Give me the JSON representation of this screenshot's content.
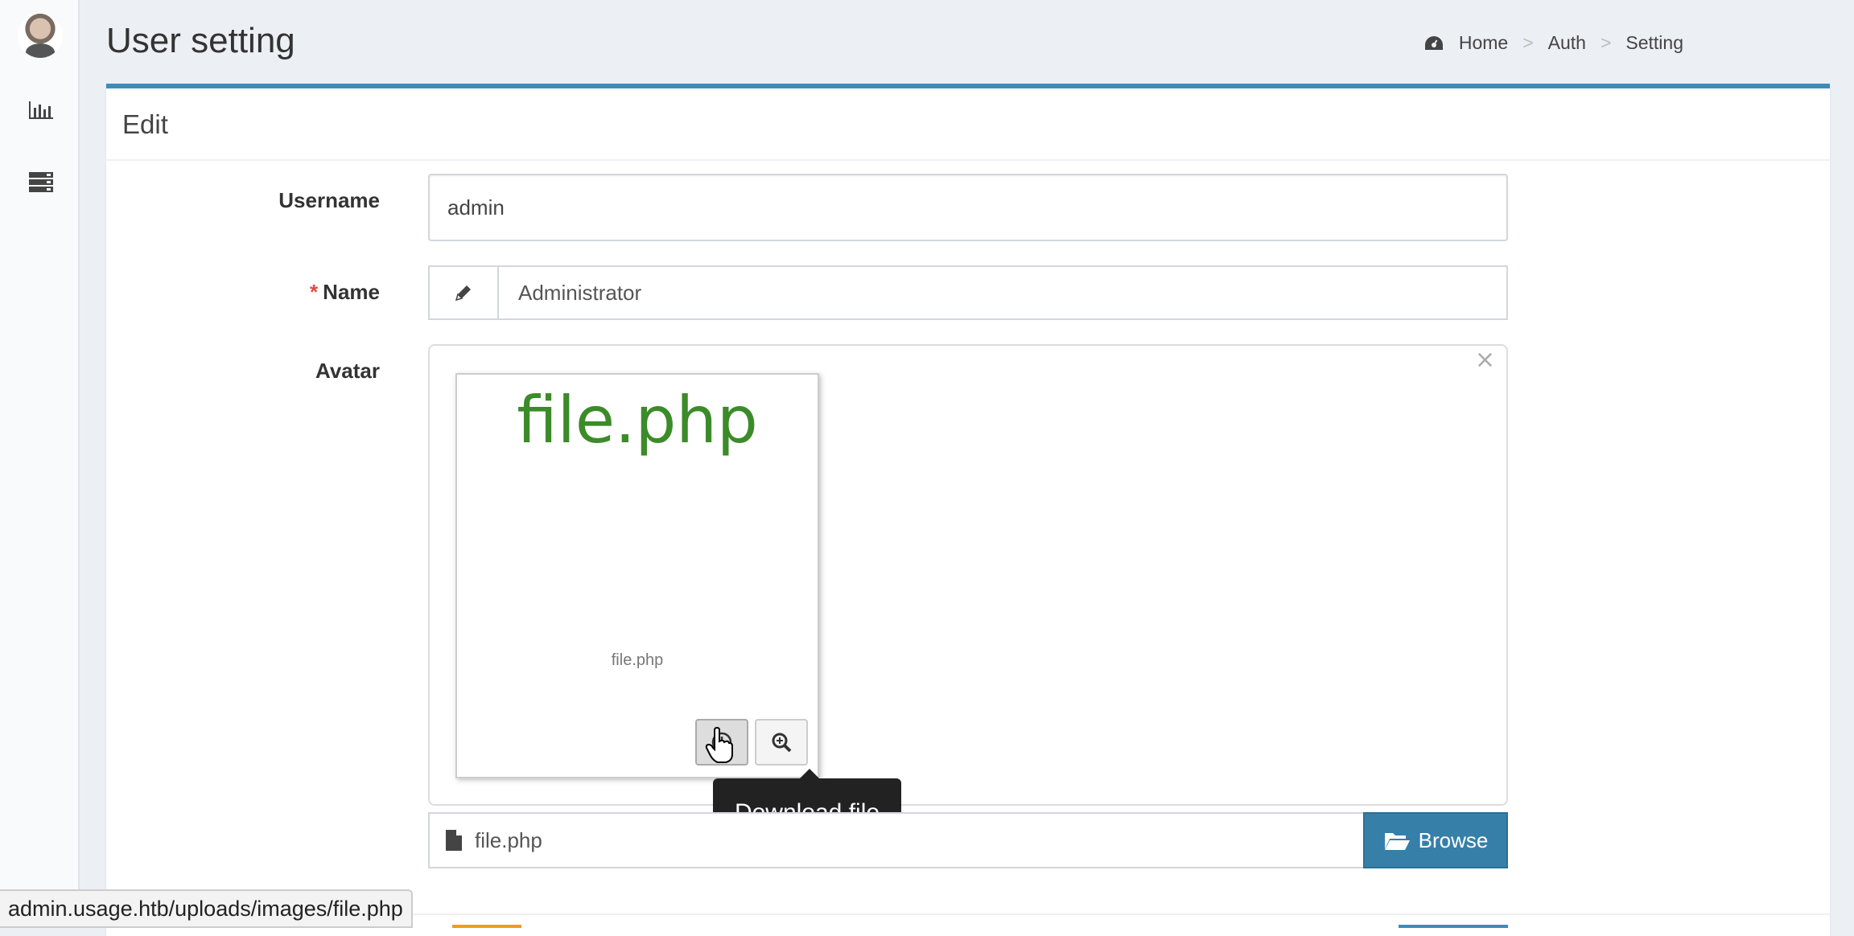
{
  "header": {
    "title": "User setting",
    "breadcrumb": [
      "Home",
      "Auth",
      "Setting"
    ],
    "breadcrumb_separator": ">"
  },
  "sidebar": {
    "icons": [
      "avatar",
      "bar-chart-icon",
      "server-icon"
    ]
  },
  "box": {
    "title": "Edit"
  },
  "form": {
    "username": {
      "label": "Username",
      "value": "admin"
    },
    "name": {
      "label": "Name",
      "required_mark": "*",
      "value": "Administrator",
      "addon_icon": "pencil-icon"
    },
    "avatar": {
      "label": "Avatar",
      "close_symbol": "×",
      "preview_title": "file.php",
      "preview_caption": "file.php",
      "download_tooltip": "Download file",
      "file_name": "file.php",
      "browse_label": "Browse"
    }
  },
  "statusbar": {
    "url": "admin.usage.htb/uploads/images/file.php"
  },
  "colors": {
    "accent": "#3c8dbc",
    "file_title": "#3c8b2a",
    "browse": "#367fa9",
    "required": "#dd4b39"
  }
}
